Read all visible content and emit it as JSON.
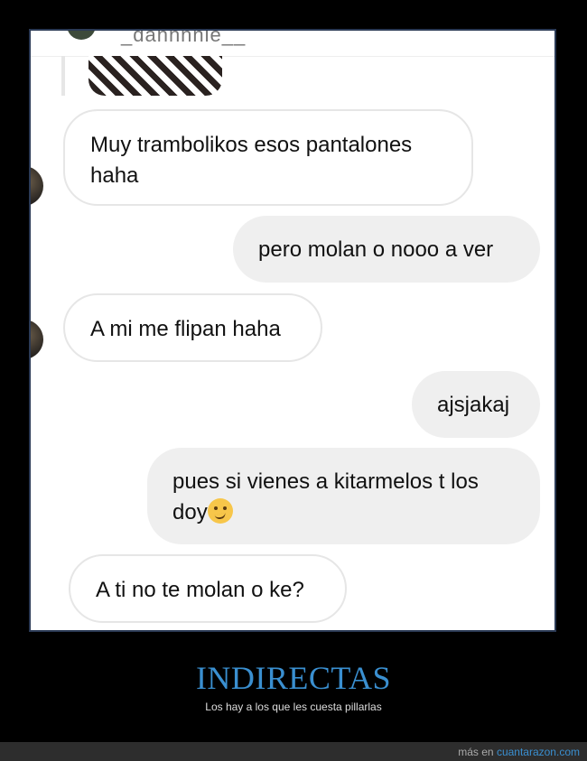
{
  "chat": {
    "username": "_dannnnie__",
    "messages": [
      {
        "direction": "in",
        "text": "Muy trambolikos esos pantalones\nhaha"
      },
      {
        "direction": "out",
        "text": "pero molan o nooo a ver"
      },
      {
        "direction": "in",
        "text": "A mi me flipan haha"
      },
      {
        "direction": "out",
        "text": "ajsjakaj"
      },
      {
        "direction": "out",
        "text": "pues si vienes a kitarmelos t los\ndoy",
        "emoji": "woozy-face"
      },
      {
        "direction": "in",
        "text": "A ti no te molan o ke?"
      }
    ]
  },
  "caption": {
    "title": "INDIRECTAS",
    "subtitle": "Los hay a los que les cuesta pillarlas"
  },
  "footer": {
    "prefix": "más en ",
    "link": "cuantarazon.com"
  },
  "colors": {
    "accent": "#3a8fd0",
    "incoming_border": "#e6e6e6",
    "outgoing_bg": "#efefef"
  }
}
